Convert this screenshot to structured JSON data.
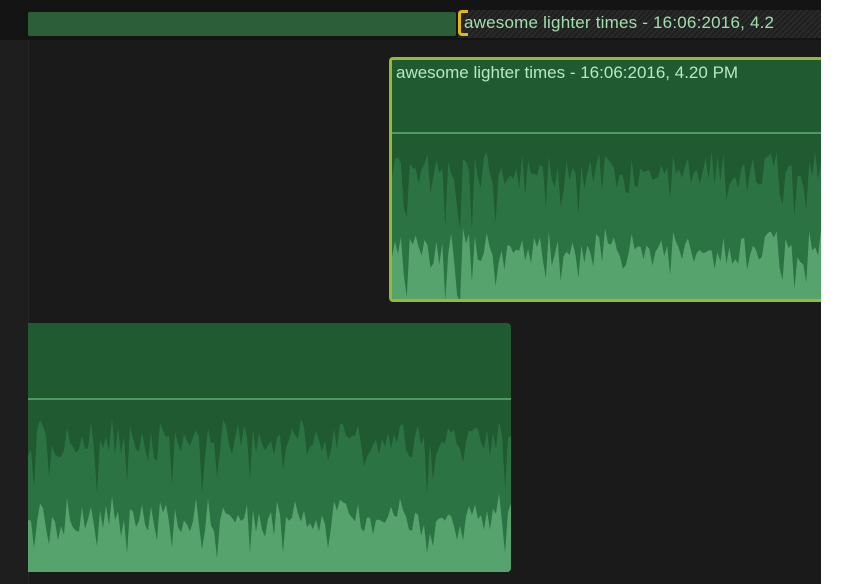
{
  "timeline": {
    "top_clip_title": "awesome lighter times - 16:06:2016, 4.2",
    "selected_clip_title": "awesome lighter times - 16:06:2016, 4.20 PM"
  },
  "colors": {
    "background": "#1a1a1a",
    "clip_fill": "#1f5a30",
    "waveform": "#56a36d",
    "selection_border": "#98b837",
    "bracket": "#e2b619",
    "title_text": "#9fe0aa"
  },
  "icons": {
    "trim_bracket": "yellow-bracket-icon"
  }
}
